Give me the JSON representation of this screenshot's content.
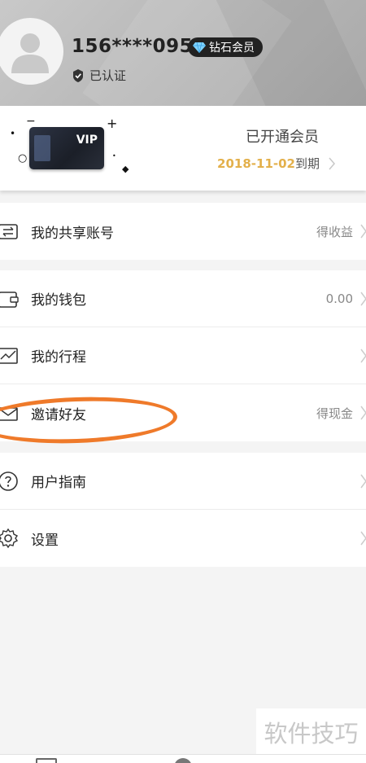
{
  "profile": {
    "phone": "156****0956",
    "badge_label": "钻石会员",
    "verified_label": "已认证"
  },
  "vip": {
    "icon_text": "VIP",
    "title": "已开通会员",
    "expire_date": "2018-11-02",
    "expire_suffix": "到期"
  },
  "menu": {
    "share_account": {
      "label": "我的共享账号",
      "value": "得收益"
    },
    "wallet": {
      "label": "我的钱包",
      "value": "0.00"
    },
    "trips": {
      "label": "我的行程"
    },
    "invite": {
      "label": "邀请好友",
      "value": "得现金"
    },
    "guide": {
      "label": "用户指南"
    },
    "settings": {
      "label": "设置"
    }
  },
  "watermark": "软件技巧",
  "colors": {
    "accent_gold": "#e3b04b",
    "annotation_orange": "#ef7a2a"
  }
}
